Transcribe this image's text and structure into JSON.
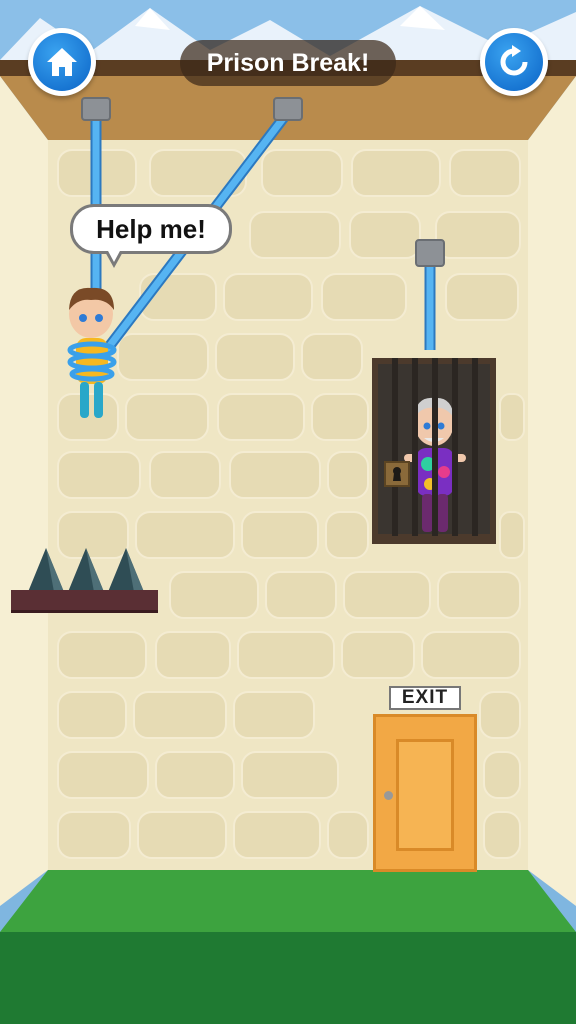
{
  "header": {
    "title": "Prison Break!",
    "home_button": {
      "icon": "home-icon"
    },
    "restart_button": {
      "icon": "restart-icon"
    }
  },
  "speech_bubble": {
    "text": "Help me!"
  },
  "exit_sign": {
    "text": "EXIT"
  },
  "colors": {
    "button_blue": "#0a7ae6",
    "rope_blue": "#47a9ee",
    "wall": "#efe6c4",
    "door": "#f2a845",
    "grass": "#3da33f"
  }
}
